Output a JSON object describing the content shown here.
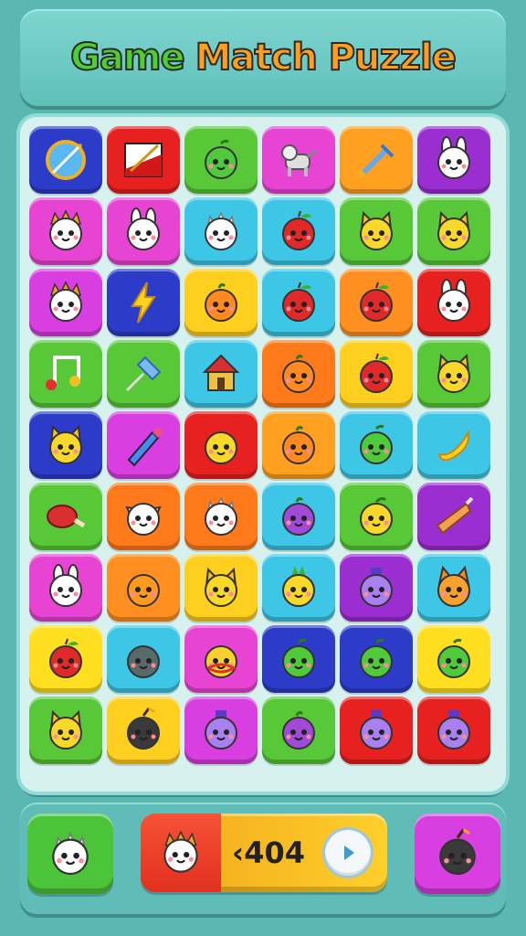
{
  "title": {
    "word1": "Game",
    "word2": "Match Puzzle"
  },
  "board": {
    "rows": [
      [
        {
          "color": "#2c3cc8",
          "icon": "compass"
        },
        {
          "color": "#e72020",
          "icon": "flag"
        },
        {
          "color": "#58c838",
          "icon": "green-fruit"
        },
        {
          "color": "#e844d4",
          "icon": "goat"
        },
        {
          "color": "#ffa020",
          "icon": "sword"
        },
        {
          "color": "#9b2ed0",
          "icon": "bunny"
        }
      ],
      [
        {
          "color": "#e844d4",
          "icon": "sun-cat"
        },
        {
          "color": "#e844d4",
          "icon": "bunny"
        },
        {
          "color": "#3ec6e6",
          "icon": "hedgehog"
        },
        {
          "color": "#3ec6e6",
          "icon": "apple"
        },
        {
          "color": "#58c838",
          "icon": "cat"
        },
        {
          "color": "#58c838",
          "icon": "cat"
        }
      ],
      [
        {
          "color": "#d83ee0",
          "icon": "sun-cat"
        },
        {
          "color": "#2c3cc8",
          "icon": "lightning"
        },
        {
          "color": "#ffcf20",
          "icon": "orange"
        },
        {
          "color": "#3ec6e6",
          "icon": "apple"
        },
        {
          "color": "#ff8f20",
          "icon": "apple"
        },
        {
          "color": "#e72020",
          "icon": "bunny"
        }
      ],
      [
        {
          "color": "#58c838",
          "icon": "music-note"
        },
        {
          "color": "#58c838",
          "icon": "push-pin"
        },
        {
          "color": "#3ec6e6",
          "icon": "house"
        },
        {
          "color": "#ff7a1a",
          "icon": "orange"
        },
        {
          "color": "#ffcf20",
          "icon": "apple"
        },
        {
          "color": "#58c838",
          "icon": "cat"
        }
      ],
      [
        {
          "color": "#2c3cc8",
          "icon": "cat"
        },
        {
          "color": "#d83ee0",
          "icon": "crayon"
        },
        {
          "color": "#e72020",
          "icon": "blob"
        },
        {
          "color": "#ffa020",
          "icon": "orange"
        },
        {
          "color": "#3ec6e6",
          "icon": "green-fruit"
        },
        {
          "color": "#3ec6e6",
          "icon": "banana"
        }
      ],
      [
        {
          "color": "#58c838",
          "icon": "drumstick"
        },
        {
          "color": "#ff7a1a",
          "icon": "dog"
        },
        {
          "color": "#ff7a1a",
          "icon": "hedgehog"
        },
        {
          "color": "#3ec6e6",
          "icon": "purple-fruit"
        },
        {
          "color": "#58c838",
          "icon": "lemon"
        },
        {
          "color": "#9b2ed0",
          "icon": "carrot"
        }
      ],
      [
        {
          "color": "#e844d4",
          "icon": "bunny"
        },
        {
          "color": "#ff8f20",
          "icon": "orange-ball"
        },
        {
          "color": "#ffcf20",
          "icon": "cat"
        },
        {
          "color": "#3ec6e6",
          "icon": "pineapple"
        },
        {
          "color": "#9b2ed0",
          "icon": "bottle"
        },
        {
          "color": "#3ec6e6",
          "icon": "fox"
        }
      ],
      [
        {
          "color": "#ffdf20",
          "icon": "apple"
        },
        {
          "color": "#3ec6e6",
          "icon": "gray-ball"
        },
        {
          "color": "#e844d4",
          "icon": "yellow-blob"
        },
        {
          "color": "#2c3cc8",
          "icon": "green-fruit"
        },
        {
          "color": "#2c3cc8",
          "icon": "green-fruit"
        },
        {
          "color": "#ffdf20",
          "icon": "green-fruit"
        }
      ],
      [
        {
          "color": "#58c838",
          "icon": "cat"
        },
        {
          "color": "#ffcf20",
          "icon": "bomb"
        },
        {
          "color": "#d83ee0",
          "icon": "bottle"
        },
        {
          "color": "#58c838",
          "icon": "purple-fruit"
        },
        {
          "color": "#e72020",
          "icon": "bottle"
        },
        {
          "color": "#e72020",
          "icon": "bottle"
        }
      ]
    ]
  },
  "bottom": {
    "left_icon": "hedgehog",
    "score_icon": "sun-cat",
    "score_text": "‹404",
    "right_icon": "bomb"
  }
}
